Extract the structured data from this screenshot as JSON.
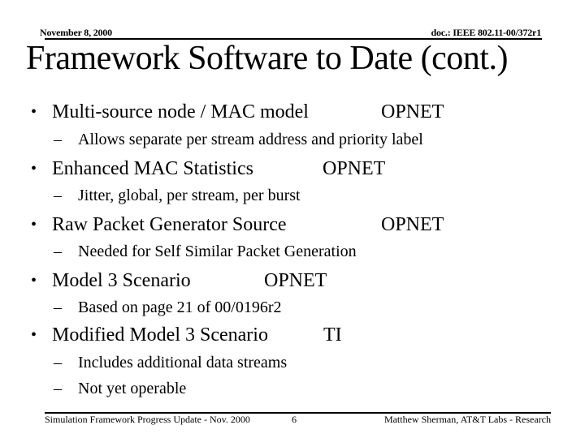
{
  "header": {
    "date": "November 8, 2000",
    "doc_id": "doc.: IEEE 802.11-00/372r1"
  },
  "title": "Framework Software to Date (cont.)",
  "bullets": [
    {
      "text": "Multi-source node / MAC model",
      "tool": "OPNET",
      "subitems": [
        "Allows separate per stream address and priority label"
      ]
    },
    {
      "text": "Enhanced MAC Statistics",
      "tool": "OPNET",
      "subitems": [
        "Jitter, global, per stream, per burst"
      ]
    },
    {
      "text": "Raw Packet Generator Source",
      "tool": "OPNET",
      "subitems": [
        "Needed for Self Similar Packet Generation"
      ]
    },
    {
      "text": "Model 3 Scenario",
      "tool": "OPNET",
      "subitems": [
        "Based on page 21 of 00/0196r2"
      ]
    },
    {
      "text": "Modified Model 3 Scenario",
      "tool": "TI",
      "subitems": [
        "Includes additional data streams",
        "Not yet operable"
      ]
    }
  ],
  "glyphs": {
    "bullet": "•",
    "dash": "–"
  },
  "footer": {
    "left": "Simulation Framework Progress Update - Nov. 2000",
    "page_number": "6",
    "right": "Matthew Sherman, AT&T Labs - Research"
  }
}
